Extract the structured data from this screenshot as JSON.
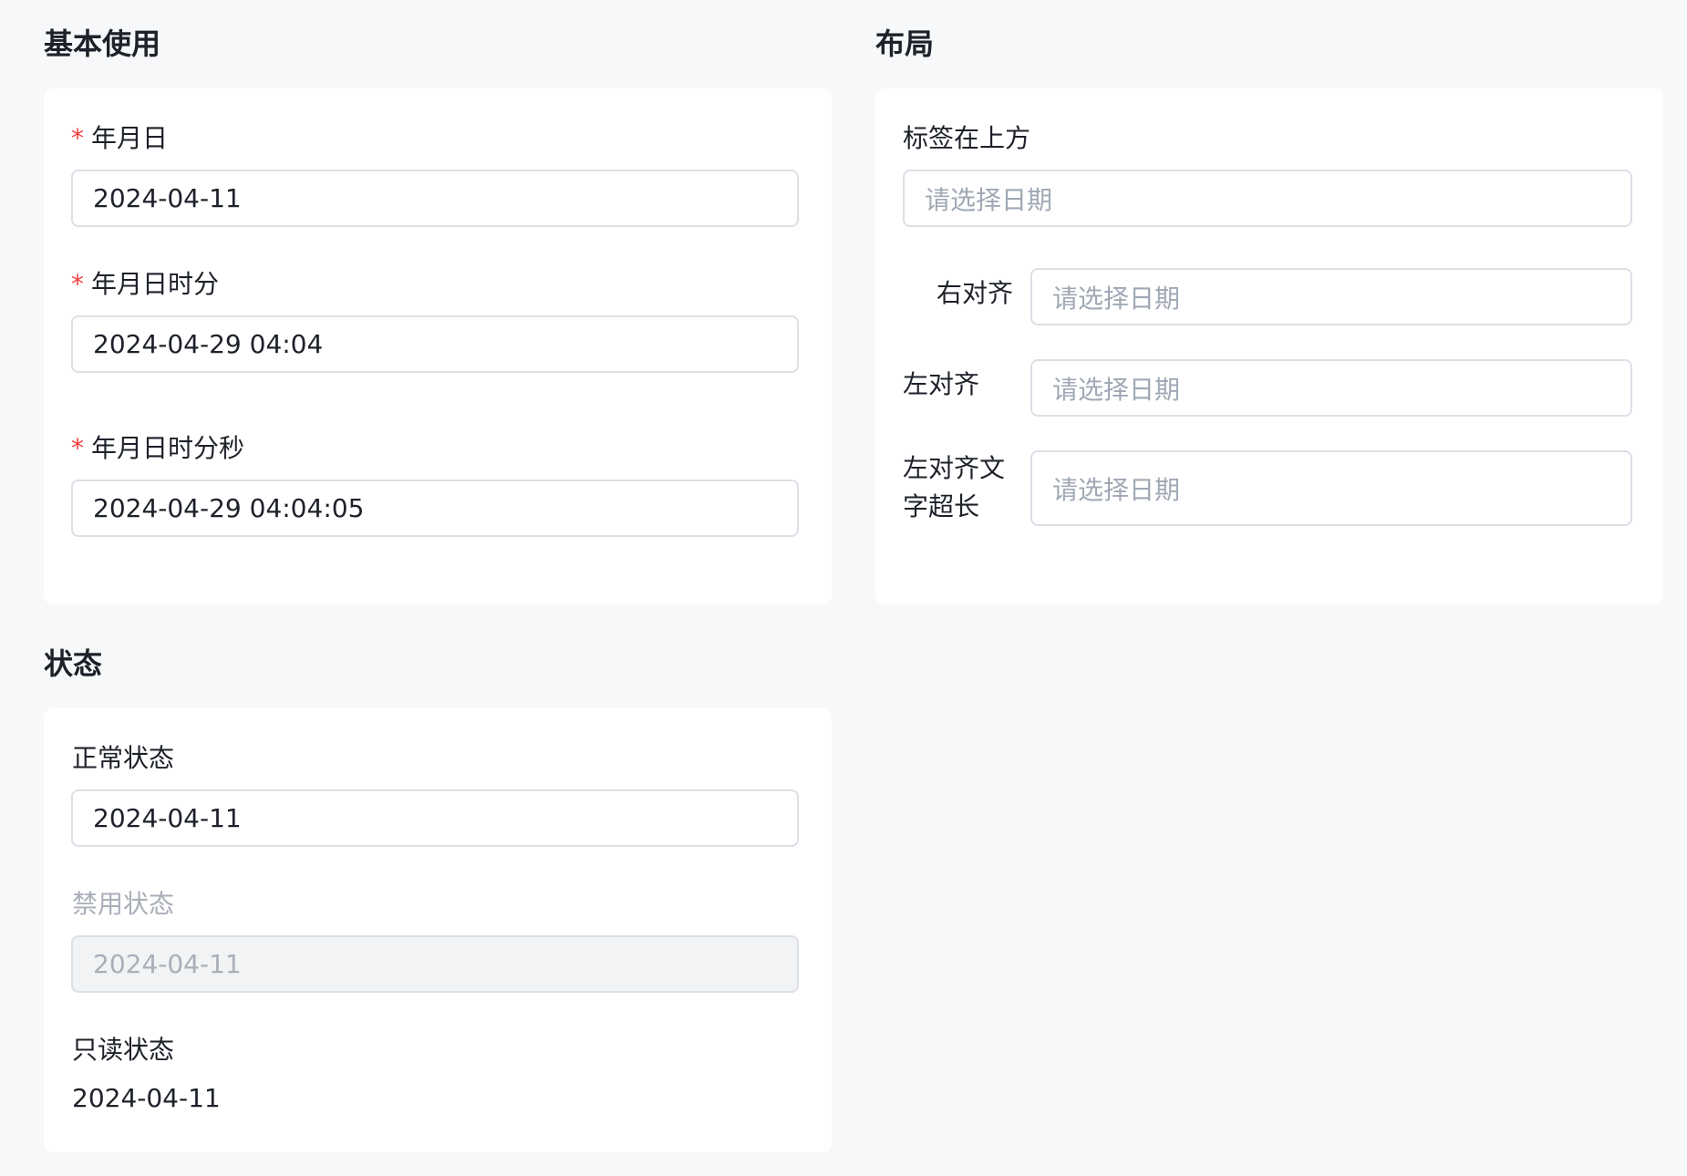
{
  "sections": {
    "basic": {
      "title": "基本使用",
      "fields": [
        {
          "required": "*",
          "label": "年月日",
          "value": "2024-04-11"
        },
        {
          "required": "*",
          "label": "年月日时分",
          "value": "2024-04-29 04:04"
        },
        {
          "required": "*",
          "label": "年月日时分秒",
          "value": "2024-04-29 04:04:05"
        }
      ]
    },
    "layout": {
      "title": "布局",
      "fields": [
        {
          "label": "标签在上方",
          "placeholder": "请选择日期"
        },
        {
          "label": "右对齐",
          "placeholder": "请选择日期"
        },
        {
          "label": "左对齐",
          "placeholder": "请选择日期"
        },
        {
          "label": "左对齐文字超长",
          "placeholder": "请选择日期"
        }
      ]
    },
    "state": {
      "title": "状态",
      "fields": [
        {
          "label": "正常状态",
          "value": "2024-04-11"
        },
        {
          "label": "禁用状态",
          "value": "2024-04-11"
        },
        {
          "label": "只读状态",
          "value": "2024-04-11"
        }
      ]
    }
  },
  "colors": {
    "page_bg": "#f7f8fa",
    "card_bg": "#ffffff",
    "required": "#f53f3f",
    "placeholder": "#a0a8b5",
    "disabled_bg": "#f2f3f5",
    "disabled_text": "#a9aeb8",
    "border": "#dcdfe6"
  }
}
